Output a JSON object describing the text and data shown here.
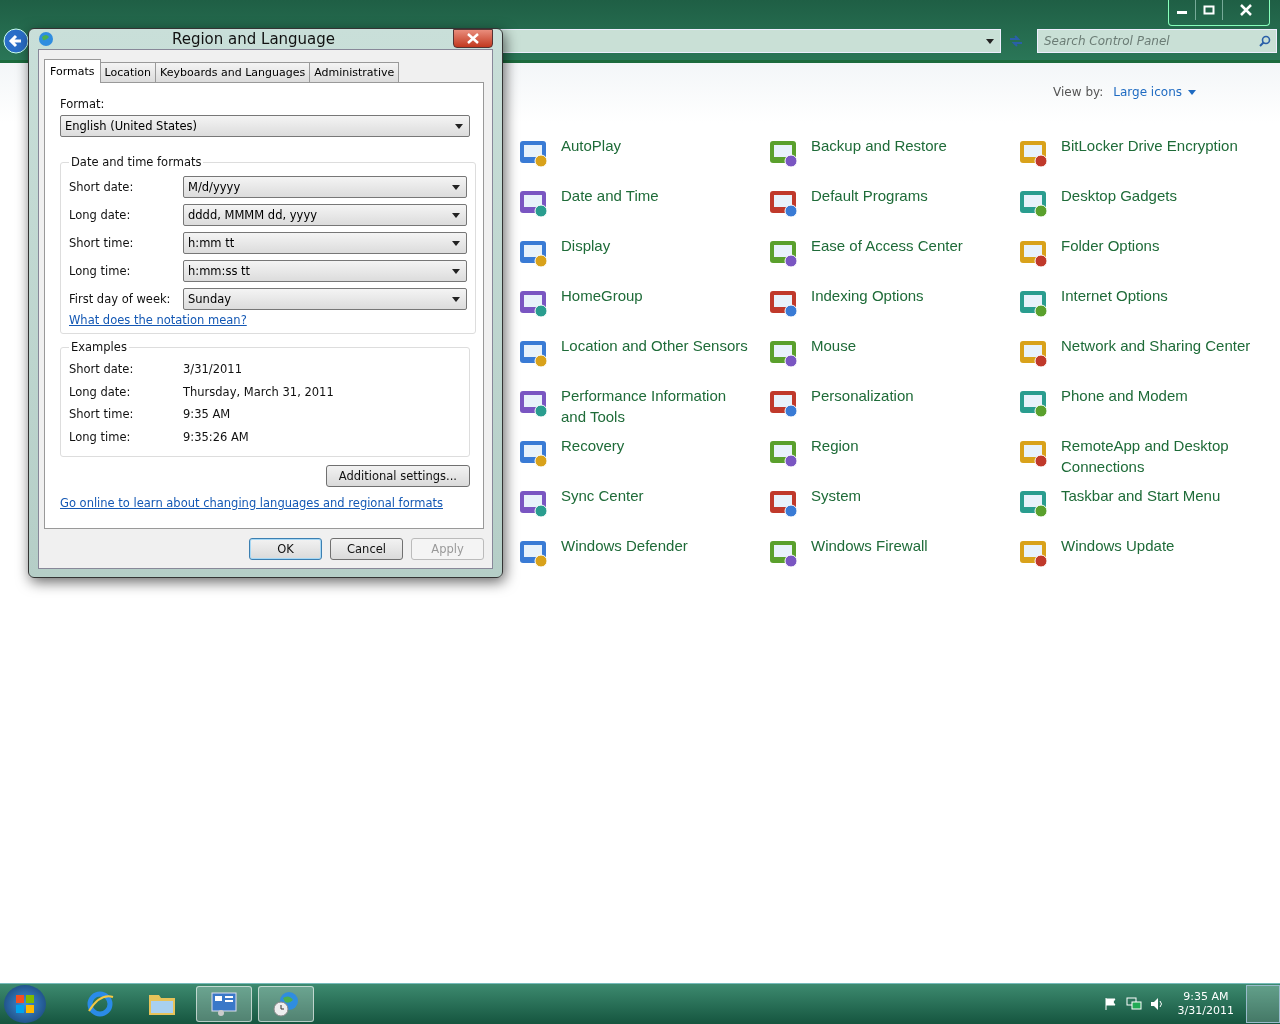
{
  "window": {
    "search": {
      "placeholder": "Search Control Panel"
    },
    "view_by": {
      "label": "View by:",
      "value": "Large icons"
    }
  },
  "items": [
    "AutoPlay",
    "Backup and Restore",
    "BitLocker Drive Encryption",
    "Date and Time",
    "Default Programs",
    "Desktop Gadgets",
    "Display",
    "Ease of Access Center",
    "Folder Options",
    "HomeGroup",
    "Indexing Options",
    "Internet Options",
    "Location and Other Sensors",
    "Mouse",
    "Network and Sharing Center",
    "Performance Information and Tools",
    "Personalization",
    "Phone and Modem",
    "Recovery",
    "Region",
    "RemoteApp and Desktop Connections",
    "Sync Center",
    "System",
    "Taskbar and Start Menu",
    "Windows Defender",
    "Windows Firewall",
    "Windows Update"
  ],
  "dialog": {
    "title": "Region and Language",
    "tabs": [
      {
        "label": "Formats",
        "selected": true
      },
      {
        "label": "Location",
        "selected": false
      },
      {
        "label": "Keyboards and Languages",
        "selected": false
      },
      {
        "label": "Administrative",
        "selected": false
      }
    ],
    "format_label": "Format:",
    "format_value": "English (United States)",
    "formats_group": {
      "title": "Date and time formats",
      "rows": [
        {
          "label": "Short date:",
          "value": "M/d/yyyy"
        },
        {
          "label": "Long date:",
          "value": "dddd, MMMM dd, yyyy"
        },
        {
          "label": "Short time:",
          "value": "h:mm tt"
        },
        {
          "label": "Long time:",
          "value": "h:mm:ss tt"
        },
        {
          "label": "First day of week:",
          "value": "Sunday"
        }
      ],
      "link": "What does the notation mean?"
    },
    "examples": {
      "title": "Examples",
      "rows": [
        {
          "label": "Short date:",
          "value": "3/31/2011"
        },
        {
          "label": "Long date:",
          "value": "Thursday, March 31, 2011"
        },
        {
          "label": "Short time:",
          "value": "9:35 AM"
        },
        {
          "label": "Long time:",
          "value": "9:35:26 AM"
        }
      ]
    },
    "additional_button": "Additional settings...",
    "online_link": "Go online to learn about changing languages and regional formats",
    "buttons": [
      {
        "label": "OK",
        "default": true,
        "disabled": false
      },
      {
        "label": "Cancel",
        "default": false,
        "disabled": false
      },
      {
        "label": "Apply",
        "default": false,
        "disabled": true
      }
    ]
  },
  "taskbar": {
    "buttons": [
      {
        "kind": "browser",
        "selected": false
      },
      {
        "kind": "folder",
        "selected": false
      },
      {
        "kind": "control-panel",
        "selected": true
      },
      {
        "kind": "globe-clock",
        "selected": true
      }
    ],
    "clock": {
      "time": "9:35 AM",
      "date": "3/31/2011"
    }
  }
}
